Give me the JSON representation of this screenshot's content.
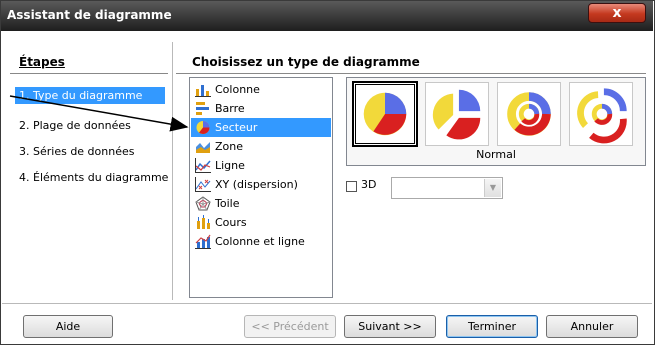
{
  "window": {
    "title": "Assistant de diagramme",
    "close_label": "x"
  },
  "steps": {
    "heading": "Étapes",
    "items": [
      {
        "label": "1. Type du diagramme",
        "selected": true
      },
      {
        "label": "2. Plage de données",
        "selected": false
      },
      {
        "label": "3. Séries de données",
        "selected": false
      },
      {
        "label": "4. Éléments du diagramme",
        "selected": false
      }
    ]
  },
  "chart_type": {
    "heading": "Choisissez un type de diagramme",
    "items": [
      {
        "label": "Colonne",
        "icon": "column-chart-icon"
      },
      {
        "label": "Barre",
        "icon": "bar-chart-icon"
      },
      {
        "label": "Secteur",
        "icon": "pie-chart-icon",
        "selected": true
      },
      {
        "label": "Zone",
        "icon": "area-chart-icon"
      },
      {
        "label": "Ligne",
        "icon": "line-chart-icon"
      },
      {
        "label": "XY (dispersion)",
        "icon": "scatter-chart-icon"
      },
      {
        "label": "Toile",
        "icon": "net-chart-icon"
      },
      {
        "label": "Cours",
        "icon": "stock-chart-icon"
      },
      {
        "label": "Colonne et ligne",
        "icon": "column-line-chart-icon"
      }
    ],
    "variant_caption": "Normal",
    "option_3d_label": "3D"
  },
  "buttons": {
    "help": "Aide",
    "previous": "<< Précédent",
    "next": "Suivant >>",
    "finish": "Terminer",
    "cancel": "Annuler"
  },
  "colors": {
    "selection": "#3399ff",
    "pie_blue": "#5a6ee6",
    "pie_yellow": "#f2d93a",
    "pie_red": "#d92020"
  }
}
